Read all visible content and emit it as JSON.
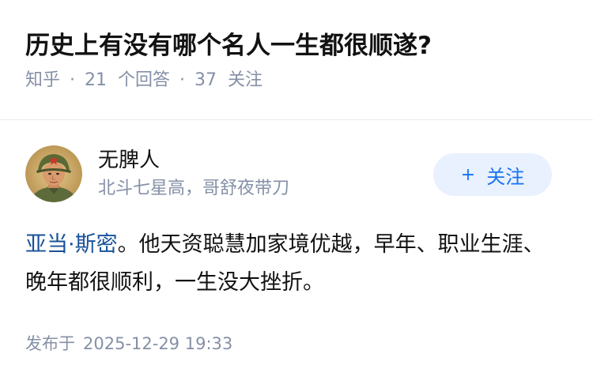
{
  "question": {
    "title": "历史上有没有哪个名人一生都很顺遂?",
    "source": "知乎",
    "answers_count": "21",
    "answers_label": "个回答",
    "follows_count": "37",
    "follows_label": "关注",
    "separator": "·"
  },
  "answer": {
    "author_name": "无脾人",
    "author_bio": "北斗七星高，哥舒夜带刀",
    "avatar_icon": "soldier-avatar",
    "follow_icon": "plus-icon",
    "follow_label": "关注",
    "body_link": "亚当·斯密",
    "body_text": "。他天资聪慧加家境优越，早年、职业生涯、晚年都很顺利，一生没大挫折。",
    "published_label": "发布于",
    "published_date": "2025-12-29 19:33"
  },
  "colors": {
    "follow_button_bg": "#e8f1fd",
    "follow_button_text": "#1772f6",
    "link": "#175199",
    "meta": "#8590a6"
  }
}
